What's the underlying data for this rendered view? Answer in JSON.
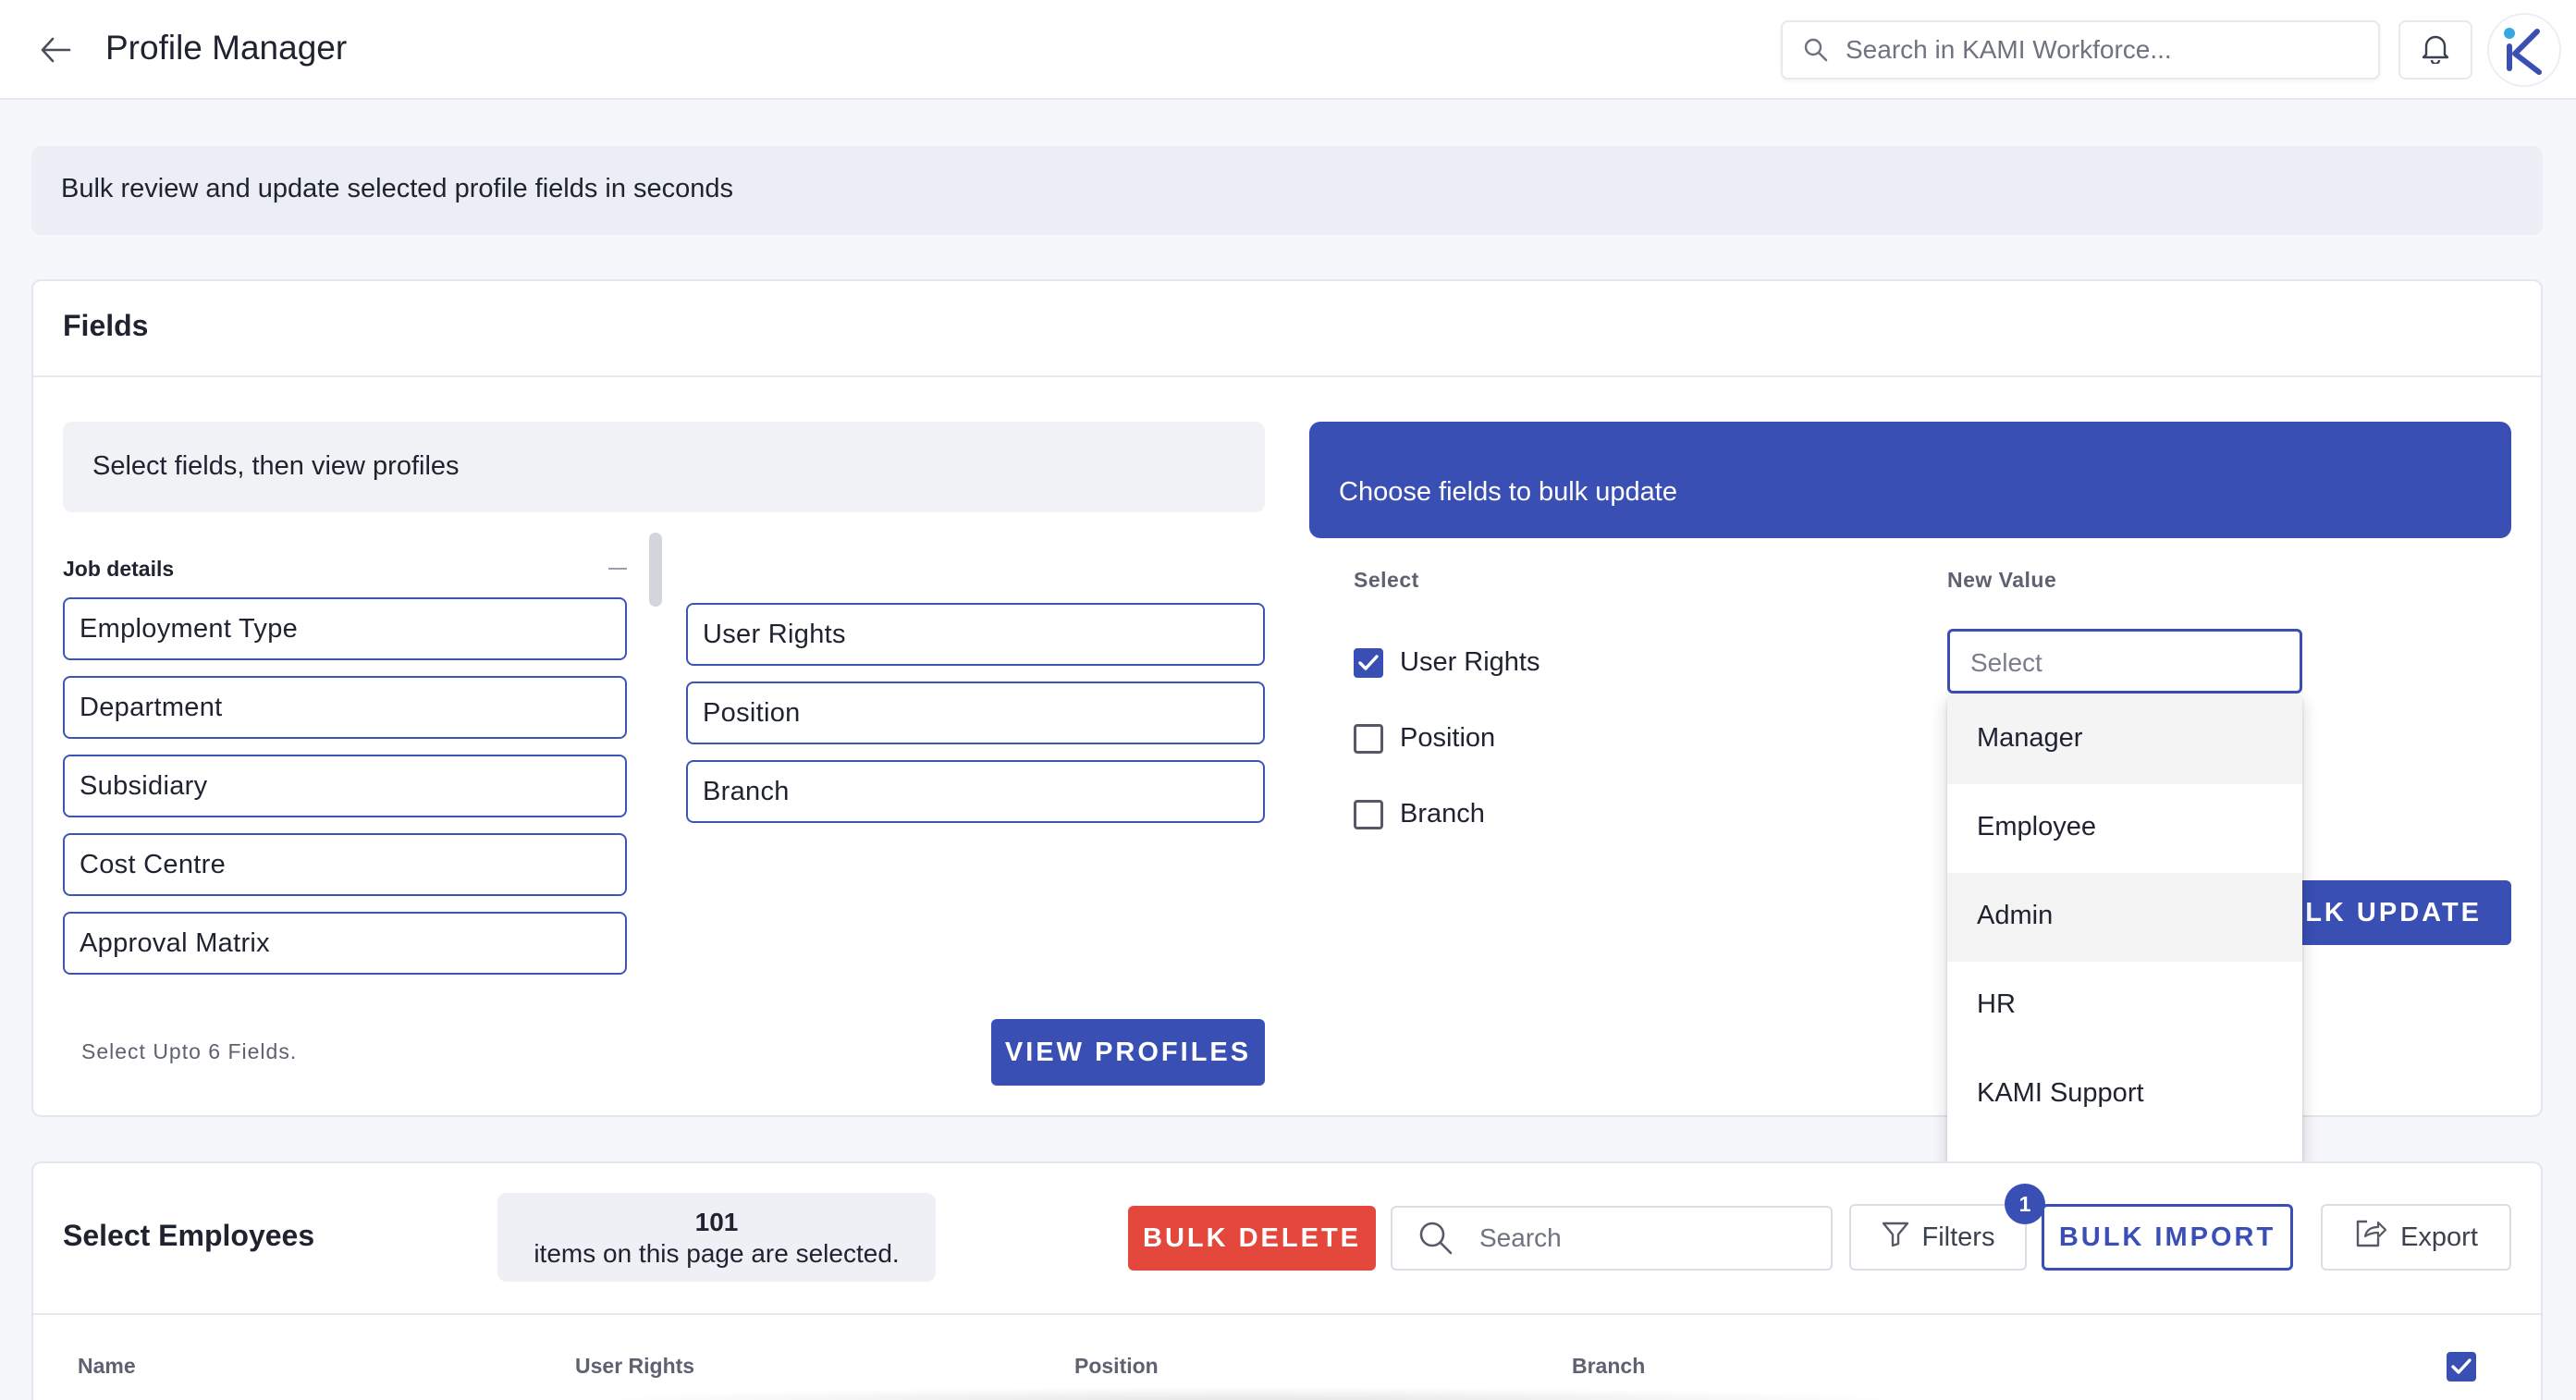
{
  "header": {
    "title": "Profile Manager",
    "search_placeholder": "Search in KAMI Workforce..."
  },
  "banner": {
    "text": "Bulk review and update selected profile fields in seconds"
  },
  "fields": {
    "title": "Fields",
    "left_heading": "Select fields, then view profiles",
    "group_label": "Job details",
    "job_details": [
      "Employment Type",
      "Department",
      "Subsidiary",
      "Cost Centre",
      "Approval Matrix"
    ],
    "selected_fields": [
      "User Rights",
      "Position",
      "Branch"
    ],
    "hint": "Select Upto 6 Fields.",
    "view_profiles_label": "VIEW PROFILES",
    "right_heading": "Choose fields to bulk update",
    "select_col_label": "Select",
    "new_value_col_label": "New Value",
    "checkboxes": [
      {
        "label": "User Rights",
        "checked": true
      },
      {
        "label": "Position",
        "checked": false
      },
      {
        "label": "Branch",
        "checked": false
      }
    ],
    "select_placeholder": "Select",
    "bulk_update_label": "ULK UPDATE",
    "dropdown_options": [
      "Manager",
      "Employee",
      "Admin",
      "HR",
      "KAMI Support"
    ]
  },
  "employees": {
    "title": "Select Employees",
    "selected_count": "101",
    "selected_msg": "items on this page are selected.",
    "bulk_delete_label": "BULK DELETE",
    "search_placeholder": "Search",
    "filters_label": "Filters",
    "filters_badge": "1",
    "bulk_import_label": "BULK IMPORT",
    "export_label": "Export",
    "columns": [
      "Name",
      "User Rights",
      "Position",
      "Branch"
    ]
  },
  "colors": {
    "primary": "#3a4fb4",
    "danger": "#e4473b",
    "logo_accent": "#3ba7e0"
  }
}
